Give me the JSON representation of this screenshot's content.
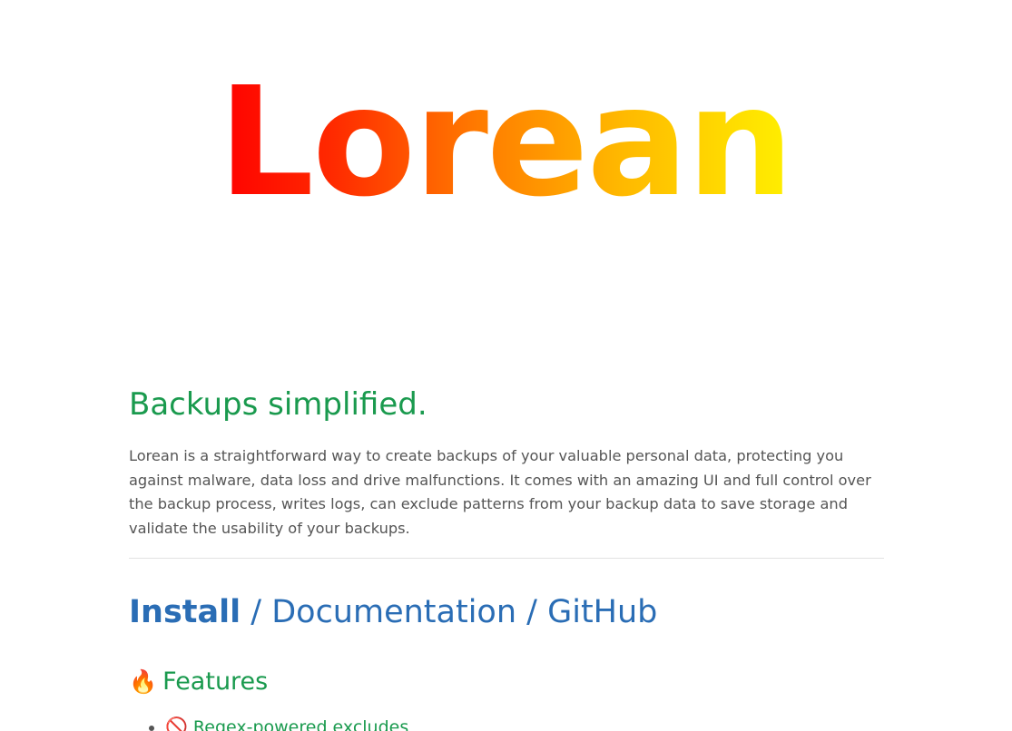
{
  "logo": {
    "text": "Lorean"
  },
  "tagline": "Backups simplified.",
  "intro": "Lorean is a straightforward way to create backups of your valuable personal data, protecting you against malware, data loss and drive malfunctions. It comes with an amazing UI and full control over the backup process, writes logs, can exclude patterns from your backup data to save storage and validate the usability of your backups.",
  "links": {
    "install": "Install",
    "separator": "/",
    "documentation": "Documentation",
    "github": "GitHub"
  },
  "features": {
    "icon": "fire-icon",
    "title": "Features",
    "items": [
      {
        "icon": "no-entry-icon",
        "label": "Regex-powered excludes"
      }
    ]
  },
  "colors": {
    "green": "#1a9a4e",
    "blue": "#2a6db5",
    "body_text": "#555555",
    "logo_gradient_start": "#ff0000",
    "logo_gradient_end": "#fff000"
  }
}
